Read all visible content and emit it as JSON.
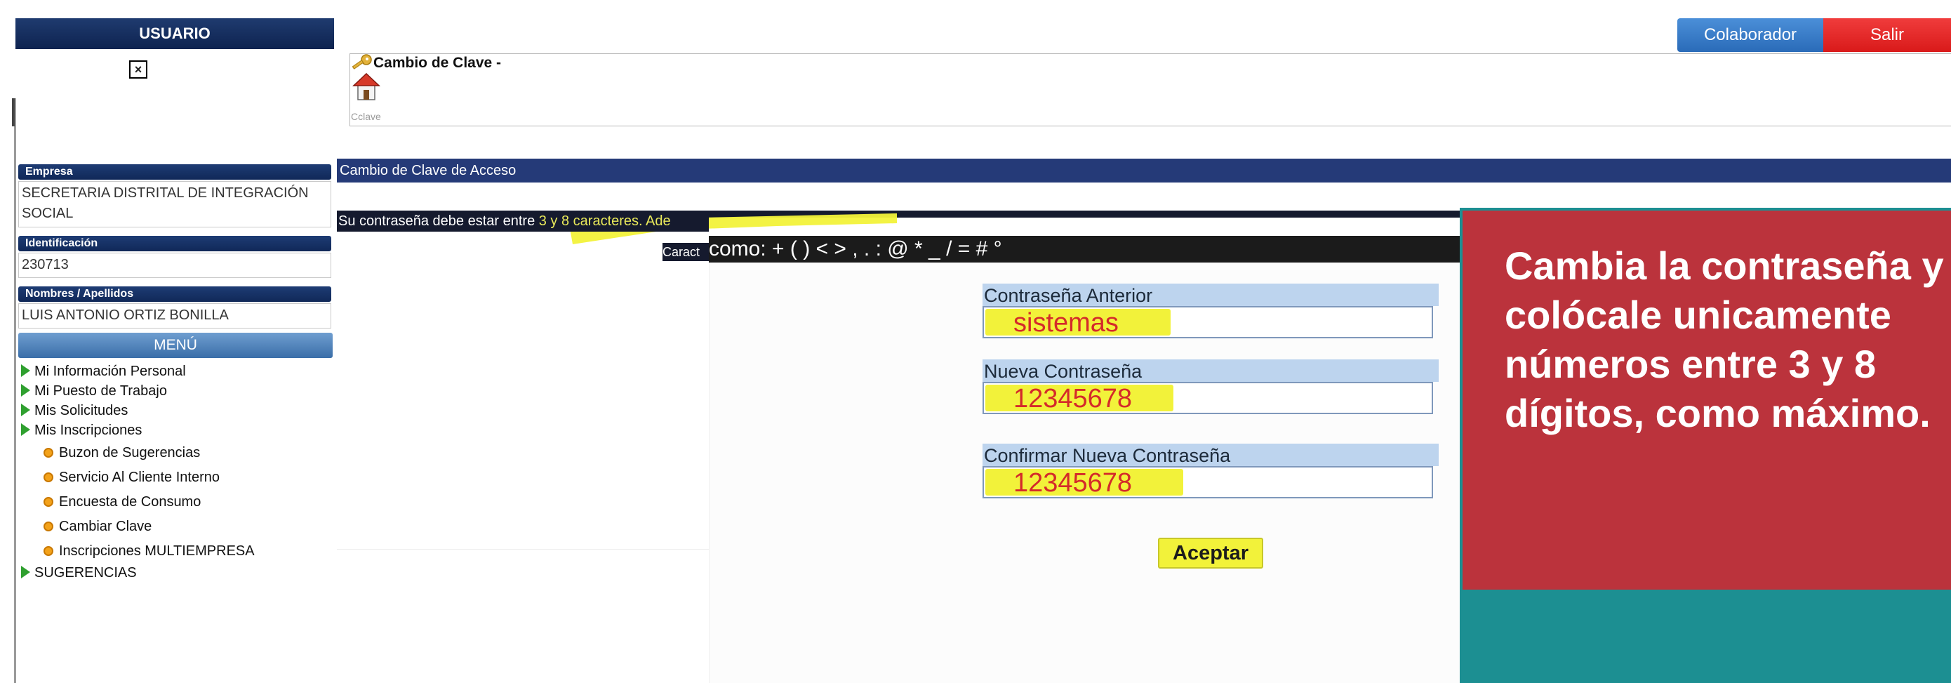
{
  "sidebar": {
    "header": "USUARIO",
    "photo_icon": "broken-image-icon",
    "empresa": {
      "label": "Empresa",
      "value": "SECRETARIA DISTRITAL DE INTEGRACIÓN SOCIAL"
    },
    "identificacion": {
      "label": "Identificación",
      "value": "230713"
    },
    "nombres": {
      "label": "Nombres / Apellidos",
      "value": "LUIS ANTONIO ORTIZ BONILLA"
    },
    "menu_header": "MENÚ",
    "menu": [
      "Mi Información Personal",
      "Mi Puesto de Trabajo",
      "Mis Solicitudes",
      "Mis Inscripciones"
    ],
    "sub_menu": [
      "Buzon de Sugerencias",
      "Servicio Al Cliente Interno",
      "Encuesta de Consumo",
      "Cambiar Clave",
      "Inscripciones MULTIEMPRESA"
    ],
    "last_menu": "SUGERENCIAS"
  },
  "header": {
    "colaborador_label": "Colaborador",
    "salir_label": "Salir",
    "colaborador_color": "#2a6bb8",
    "salir_color": "#e02020"
  },
  "content": {
    "title": "Cambio de Clave -",
    "title_icon": "key-icon",
    "home_icon": "home-icon",
    "home_caption": "Cclave",
    "banner": "Cambio de Clave de Acceso",
    "instruction_prefix": "Su contraseña debe estar entre ",
    "instruction_highlight": "3 y 8 caracteres. Ade",
    "caract_fragment": "Caract",
    "allowed_chars": "como: + ( ) < > , . : @ * _ / = # °"
  },
  "form": {
    "old_password": {
      "label": "Contraseña Anterior",
      "value": "sistemas"
    },
    "new_password": {
      "label": "Nueva Contraseña",
      "value": "12345678"
    },
    "confirm_password": {
      "label": "Confirmar Nueva Contraseña",
      "value": "12345678"
    },
    "accept_label": "Aceptar",
    "highlight_color": "#f2f23a"
  },
  "callout": {
    "text": "Cambia la contraseña y colócale unicamente números entre 3 y 8 dígitos, como máximo.",
    "bg_color": "#bb333c",
    "panel_color": "#1c8f92"
  }
}
